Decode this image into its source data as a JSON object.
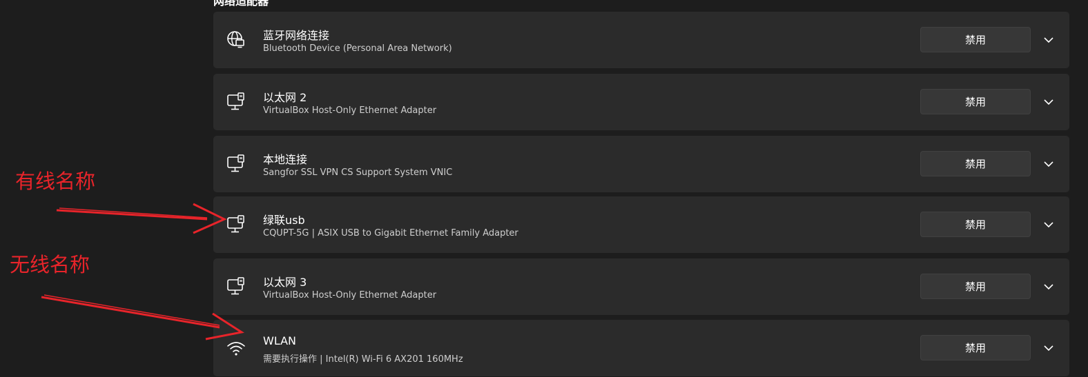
{
  "section": {
    "header": "网络适配器"
  },
  "adapters": [
    {
      "name": "蓝牙网络连接",
      "description": "Bluetooth Device (Personal Area Network)",
      "icon": "globe-network-icon",
      "button_label": "禁用"
    },
    {
      "name": "以太网 2",
      "description": "VirtualBox Host-Only Ethernet Adapter",
      "icon": "ethernet-icon",
      "button_label": "禁用"
    },
    {
      "name": "本地连接",
      "description": "Sangfor SSL VPN CS Support System VNIC",
      "icon": "ethernet-icon",
      "button_label": "禁用"
    },
    {
      "name": "绿联usb",
      "description": "CQUPT-5G | ASIX USB to Gigabit Ethernet Family Adapter",
      "icon": "ethernet-icon",
      "button_label": "禁用"
    },
    {
      "name": "以太网 3",
      "description": "VirtualBox Host-Only Ethernet Adapter",
      "icon": "ethernet-icon",
      "button_label": "禁用"
    },
    {
      "name": "WLAN",
      "description": "需要执行操作 | Intel(R) Wi-Fi 6 AX201 160MHz",
      "icon": "wifi-icon",
      "button_label": "禁用"
    }
  ],
  "annotations": {
    "wired_label": "有线名称",
    "wireless_label": "无线名称",
    "color": "#e8242a"
  },
  "colors": {
    "background": "#1d1d1d",
    "card": "#2b2b2b",
    "button": "#373737",
    "text_primary": "#ffffff",
    "text_secondary": "#cfcfcf"
  }
}
